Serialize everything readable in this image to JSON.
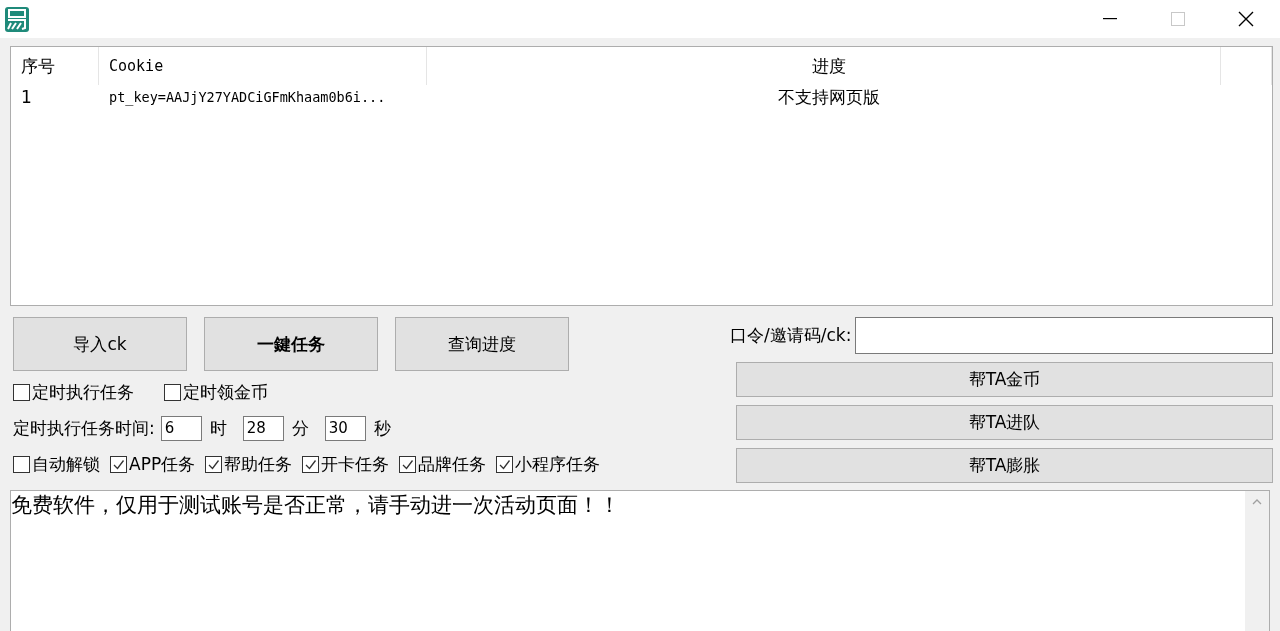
{
  "window": {
    "controls": [
      {
        "kind": "minimize",
        "disabled": false
      },
      {
        "kind": "maximize",
        "disabled": true
      },
      {
        "kind": "close",
        "disabled": false
      }
    ]
  },
  "table": {
    "columns": [
      "序号",
      "Cookie",
      "进度"
    ],
    "rows": [
      [
        "1",
        "pt_key=AAJjY27YADCiGFmKhaam0b6i...",
        "不支持网页版"
      ]
    ]
  },
  "actions": [
    {
      "label": "导入ck",
      "kind": "normal"
    },
    {
      "label": "一鍵任务",
      "kind": "primary"
    },
    {
      "label": "查询进度",
      "kind": "normal"
    }
  ],
  "schedule_options": [
    {
      "label": "定时执行任务",
      "checked": false
    },
    {
      "label": "定时领金币",
      "checked": false
    }
  ],
  "schedule_time": {
    "label": "定时执行任务时间:",
    "fields": [
      {
        "value": "6",
        "unit": "时"
      },
      {
        "value": "28",
        "unit": "分"
      },
      {
        "value": "30",
        "unit": "秒"
      }
    ]
  },
  "task_options": [
    {
      "label": "自动解锁",
      "checked": false
    },
    {
      "label": "APP任务",
      "checked": true
    },
    {
      "label": "帮助任务",
      "checked": true
    },
    {
      "label": "开卡任务",
      "checked": true
    },
    {
      "label": "品牌任务",
      "checked": true
    },
    {
      "label": "小程序任务",
      "checked": true
    }
  ],
  "invite": {
    "label": "口令/邀请码/ck:"
  },
  "help_buttons": [
    "帮TA金币",
    "帮TA进队",
    "帮TA膨胀"
  ],
  "log": {
    "text": "免费软件，仅用于测试账号是否正常，请手动进一次活动页面！！"
  }
}
